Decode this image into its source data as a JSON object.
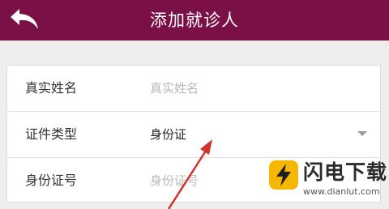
{
  "header": {
    "title": "添加就诊人",
    "back_icon": "back-arrow-icon",
    "background_color": "#7a1045"
  },
  "form": {
    "rows": [
      {
        "label": "真实姓名",
        "placeholder": "真实姓名",
        "value": ""
      },
      {
        "label": "证件类型",
        "value": "身份证",
        "dropdown_icon": "caret-down-icon"
      },
      {
        "label": "身份证号",
        "placeholder": "身份证号",
        "value": ""
      }
    ]
  },
  "annotation": {
    "arrow_color": "#d0342c"
  },
  "watermark": {
    "name": "闪电下载",
    "url": "www.dianlut.com",
    "logo_color": "#f6b700"
  }
}
